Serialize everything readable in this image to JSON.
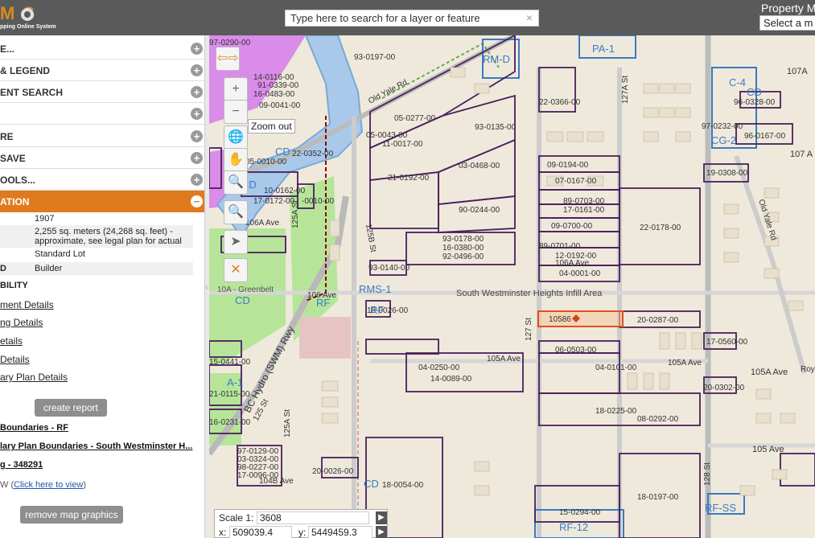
{
  "header": {
    "logo_letters": "M S",
    "logo_subtitle": "pping Online System",
    "search_placeholder": "Type here to search for a layer or feature",
    "search_clear": "×",
    "property_label": "Property M",
    "property_select": "Select a m"
  },
  "sidebar": {
    "accordion": [
      {
        "label": "E...",
        "icon": "+"
      },
      {
        "label": "& LEGEND",
        "icon": "+"
      },
      {
        "label": "ENT SEARCH",
        "icon": "+"
      },
      {
        "label": "",
        "icon": "+"
      },
      {
        "label": "RE",
        "icon": "+"
      },
      {
        "label": "SAVE",
        "icon": "+"
      },
      {
        "label": "OOLS...",
        "icon": "+"
      },
      {
        "label": "ATION",
        "icon": "−"
      }
    ],
    "info": [
      {
        "key": "",
        "value": "1907"
      },
      {
        "key": "",
        "value": "2,255 sq. meters (24,268 sq. feet) - approximate, see legal plan for actual"
      },
      {
        "key": "",
        "value": "Standard Lot"
      },
      {
        "key": "D",
        "value": "Builder"
      },
      {
        "key": "BILITY",
        "value": ""
      }
    ],
    "links": [
      "ment Details",
      "ng Details",
      "etails",
      "Details",
      "ary Plan Details"
    ],
    "create_report": "create report",
    "bold_links": [
      "Boundaries - RF",
      "lary Plan Boundaries - South Westminster H...",
      "g - 348291"
    ],
    "view_prefix": "W (",
    "view_link": "Click here to view",
    "view_suffix": ")",
    "remove_graphics": "remove map graphics"
  },
  "map": {
    "zoom_tooltip": "Zoom out",
    "tools": [
      "+",
      "−",
      "🌐",
      "✋",
      "🔍",
      "🔍",
      "➤",
      "✕"
    ],
    "scale_label": "Scale 1:",
    "scale_value": "3608",
    "x_label": "x:",
    "x_value": "509039.4",
    "y_label": "y:",
    "y_value": "5449459.3",
    "go": "▶",
    "labels": [
      {
        "t": "93-0197-00",
        "c": "#333"
      },
      {
        "t": "97-0290-00",
        "c": "#333"
      },
      {
        "t": "14-0116-00",
        "c": "#333"
      },
      {
        "t": "91-0339-00",
        "c": "#333"
      },
      {
        "t": "16-0483-00",
        "c": "#333"
      },
      {
        "t": "09-0041-00",
        "c": "#333"
      },
      {
        "t": "Old Yale Rd",
        "c": "#333"
      },
      {
        "t": "05-0277-00",
        "c": "#333"
      },
      {
        "t": "93-0135-00",
        "c": "#333"
      },
      {
        "t": "05-0043-00",
        "c": "#333"
      },
      {
        "t": "11-0017-00",
        "c": "#333"
      },
      {
        "t": "03-0468-00",
        "c": "#333"
      },
      {
        "t": "21-0192-00",
        "c": "#333"
      },
      {
        "t": "22-0352-00",
        "c": "#333"
      },
      {
        "t": "05-0010-00",
        "c": "#333"
      },
      {
        "t": "17-0172-00",
        "c": "#333"
      },
      {
        "t": "-0010-00",
        "c": "#333"
      },
      {
        "t": "106A Ave",
        "c": "#333"
      },
      {
        "t": "125A St",
        "c": "#333"
      },
      {
        "t": "125B St",
        "c": "#333"
      },
      {
        "t": "90-0244-00",
        "c": "#333"
      },
      {
        "t": "93-0178-00",
        "c": "#333"
      },
      {
        "t": "16-0380-00",
        "c": "#333"
      },
      {
        "t": "92-0496-00",
        "c": "#333"
      },
      {
        "t": "93-0140-00",
        "c": "#333"
      },
      {
        "t": "RMS-1",
        "c": "#3a7bbf"
      },
      {
        "t": "106 Ave",
        "c": "#333"
      },
      {
        "t": "RF",
        "c": "#3a7bbf"
      },
      {
        "t": "CD",
        "c": "#3a7bbf"
      },
      {
        "t": "10A - Greenbelt",
        "c": "#555"
      },
      {
        "t": "BC Hydro (SWM) Rwy",
        "c": "#333"
      },
      {
        "t": "125 St",
        "c": "#333"
      },
      {
        "t": "125A St",
        "c": "#333"
      },
      {
        "t": "South Westminster Heights Infill Area",
        "c": "#444"
      },
      {
        "t": "18-0026-00",
        "c": "#333"
      },
      {
        "t": "105A Ave",
        "c": "#333"
      },
      {
        "t": "04-0250-00",
        "c": "#333"
      },
      {
        "t": "14-0089-00",
        "c": "#333"
      },
      {
        "t": "127 St",
        "c": "#333"
      },
      {
        "t": "127A St",
        "c": "#333"
      },
      {
        "t": "09-0194-00",
        "c": "#333"
      },
      {
        "t": "07-0167-00",
        "c": "#333"
      },
      {
        "t": "89-0703-00",
        "c": "#333"
      },
      {
        "t": "17-0161-00",
        "c": "#333"
      },
      {
        "t": "09-0700-00",
        "c": "#333"
      },
      {
        "t": "89-0701-00",
        "c": "#333"
      },
      {
        "t": "12-0192-00",
        "c": "#333"
      },
      {
        "t": "106A Ave",
        "c": "#333"
      },
      {
        "t": "04-0001-00",
        "c": "#333"
      },
      {
        "t": "22-0178-00",
        "c": "#333"
      },
      {
        "t": "22-0366-00",
        "c": "#333"
      },
      {
        "t": "PA-1",
        "c": "#3a7bbf"
      },
      {
        "t": "RM-D",
        "c": "#3a7bbf"
      },
      {
        "t": "20-0287-00",
        "c": "#333"
      },
      {
        "t": "06-0503-00",
        "c": "#333"
      },
      {
        "t": "04-0101-00",
        "c": "#333"
      },
      {
        "t": "105A Ave",
        "c": "#333"
      },
      {
        "t": "18-0225-00",
        "c": "#333"
      },
      {
        "t": "08-0292-00",
        "c": "#333"
      },
      {
        "t": "CD",
        "c": "#3a7bbf"
      },
      {
        "t": "18-0054-00",
        "c": "#333"
      },
      {
        "t": "18-0197-00",
        "c": "#333"
      },
      {
        "t": "15-0294-00",
        "c": "#333"
      },
      {
        "t": "RF-12",
        "c": "#3a7bbf"
      },
      {
        "t": "104B Ave",
        "c": "#333"
      },
      {
        "t": "20-0026-00",
        "c": "#333"
      },
      {
        "t": "97-0129-00",
        "c": "#333"
      },
      {
        "t": "03-0324-00",
        "c": "#333"
      },
      {
        "t": "98-0227-00",
        "c": "#333"
      },
      {
        "t": "17-0096-00",
        "c": "#333"
      },
      {
        "t": "15-0441-00",
        "c": "#333"
      },
      {
        "t": "21-0115-00",
        "c": "#333"
      },
      {
        "t": "16-0231-00",
        "c": "#333"
      },
      {
        "t": "A-1",
        "c": "#3a7bbf"
      },
      {
        "t": "C-4",
        "c": "#3a7bbf"
      },
      {
        "t": "CD",
        "c": "#3a7bbf"
      },
      {
        "t": "CG-2",
        "c": "#3a7bbf"
      },
      {
        "t": "96-0328-00",
        "c": "#333"
      },
      {
        "t": "97-0232-00",
        "c": "#333"
      },
      {
        "t": "96-0167-00",
        "c": "#333"
      },
      {
        "t": "19-0308-00",
        "c": "#333"
      },
      {
        "t": "107A",
        "c": "#333"
      },
      {
        "t": "107 A",
        "c": "#333"
      },
      {
        "t": "Old Yale Rd",
        "c": "#333"
      },
      {
        "t": "17-0560-00",
        "c": "#333"
      },
      {
        "t": "105A Ave",
        "c": "#333"
      },
      {
        "t": "20-0302-00",
        "c": "#333"
      },
      {
        "t": "105 Ave",
        "c": "#333"
      },
      {
        "t": "RF-SS",
        "c": "#3a7bbf"
      },
      {
        "t": "128 St",
        "c": "#333"
      },
      {
        "t": "Roy",
        "c": "#333"
      },
      {
        "t": "CD",
        "c": "#3a7bbf"
      },
      {
        "t": "RF",
        "c": "#3a7bbf"
      },
      {
        "t": "CD",
        "c": "#3a7bbf"
      },
      {
        "t": "10-0162-00",
        "c": "#333"
      },
      {
        "t": "10586",
        "c": "#333"
      }
    ]
  }
}
